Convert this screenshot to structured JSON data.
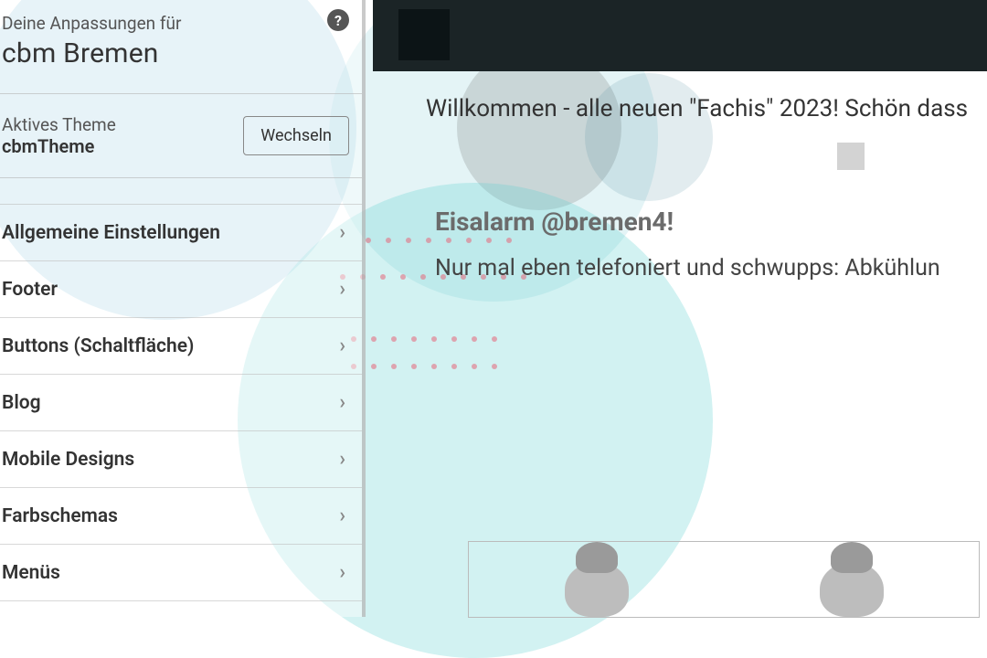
{
  "sidebar": {
    "header_line1": "Deine Anpassungen für",
    "title": "cbm Bremen",
    "help_symbol": "?",
    "theme_section": {
      "label": "Aktives Theme",
      "name": "cbmTheme",
      "switch_button": "Wechseln"
    },
    "menu": [
      "Allgemeine Einstellungen",
      "Footer",
      "Buttons (Schaltfläche)",
      "Blog",
      "Mobile Designs",
      "Farbschemas",
      "Menüs"
    ],
    "chevron": "›"
  },
  "preview": {
    "welcome": "Willkommen - alle neuen \"Fachis\" 2023! Schön dass",
    "post_title": "Eisalarm @bremen4!",
    "post_body": "Nur mal eben telefoniert und schwupps: Abkühlun"
  }
}
